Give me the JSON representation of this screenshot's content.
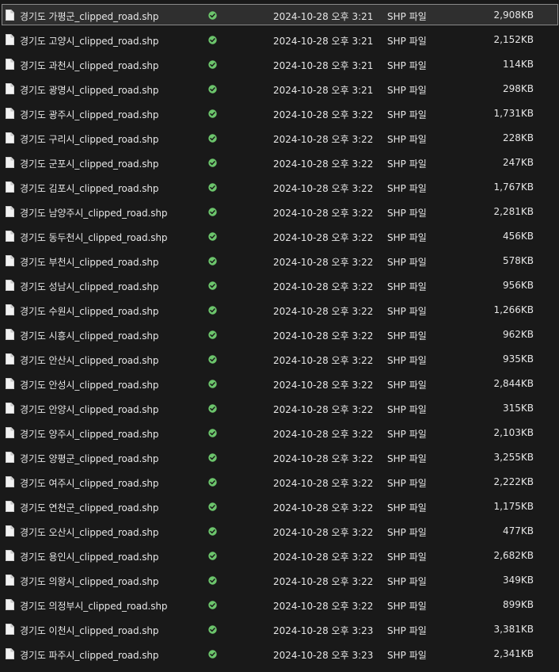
{
  "icons": {
    "file": "file-icon",
    "status": "sync-check-icon"
  },
  "colors": {
    "background": "#191919",
    "text": "#e6e6e6",
    "selection_border": "#8a8a8a",
    "status_green": "#6cc56c"
  },
  "files": [
    {
      "name": "경기도 가평군_clipped_road.shp",
      "date": "2024-10-28 오후 3:21",
      "type": "SHP 파일",
      "size": "2,908KB",
      "selected": true
    },
    {
      "name": "경기도 고양시_clipped_road.shp",
      "date": "2024-10-28 오후 3:21",
      "type": "SHP 파일",
      "size": "2,152KB"
    },
    {
      "name": "경기도 과천시_clipped_road.shp",
      "date": "2024-10-28 오후 3:21",
      "type": "SHP 파일",
      "size": "114KB"
    },
    {
      "name": "경기도 광명시_clipped_road.shp",
      "date": "2024-10-28 오후 3:21",
      "type": "SHP 파일",
      "size": "298KB"
    },
    {
      "name": "경기도 광주시_clipped_road.shp",
      "date": "2024-10-28 오후 3:22",
      "type": "SHP 파일",
      "size": "1,731KB"
    },
    {
      "name": "경기도 구리시_clipped_road.shp",
      "date": "2024-10-28 오후 3:22",
      "type": "SHP 파일",
      "size": "228KB"
    },
    {
      "name": "경기도 군포시_clipped_road.shp",
      "date": "2024-10-28 오후 3:22",
      "type": "SHP 파일",
      "size": "247KB"
    },
    {
      "name": "경기도 김포시_clipped_road.shp",
      "date": "2024-10-28 오후 3:22",
      "type": "SHP 파일",
      "size": "1,767KB"
    },
    {
      "name": "경기도 남양주시_clipped_road.shp",
      "date": "2024-10-28 오후 3:22",
      "type": "SHP 파일",
      "size": "2,281KB"
    },
    {
      "name": "경기도 동두천시_clipped_road.shp",
      "date": "2024-10-28 오후 3:22",
      "type": "SHP 파일",
      "size": "456KB"
    },
    {
      "name": "경기도 부천시_clipped_road.shp",
      "date": "2024-10-28 오후 3:22",
      "type": "SHP 파일",
      "size": "578KB"
    },
    {
      "name": "경기도 성남시_clipped_road.shp",
      "date": "2024-10-28 오후 3:22",
      "type": "SHP 파일",
      "size": "956KB"
    },
    {
      "name": "경기도 수원시_clipped_road.shp",
      "date": "2024-10-28 오후 3:22",
      "type": "SHP 파일",
      "size": "1,266KB"
    },
    {
      "name": "경기도 시흥시_clipped_road.shp",
      "date": "2024-10-28 오후 3:22",
      "type": "SHP 파일",
      "size": "962KB"
    },
    {
      "name": "경기도 안산시_clipped_road.shp",
      "date": "2024-10-28 오후 3:22",
      "type": "SHP 파일",
      "size": "935KB"
    },
    {
      "name": "경기도 안성시_clipped_road.shp",
      "date": "2024-10-28 오후 3:22",
      "type": "SHP 파일",
      "size": "2,844KB"
    },
    {
      "name": "경기도 안양시_clipped_road.shp",
      "date": "2024-10-28 오후 3:22",
      "type": "SHP 파일",
      "size": "315KB"
    },
    {
      "name": "경기도 양주시_clipped_road.shp",
      "date": "2024-10-28 오후 3:22",
      "type": "SHP 파일",
      "size": "2,103KB"
    },
    {
      "name": "경기도 양평군_clipped_road.shp",
      "date": "2024-10-28 오후 3:22",
      "type": "SHP 파일",
      "size": "3,255KB"
    },
    {
      "name": "경기도 여주시_clipped_road.shp",
      "date": "2024-10-28 오후 3:22",
      "type": "SHP 파일",
      "size": "2,222KB"
    },
    {
      "name": "경기도 연천군_clipped_road.shp",
      "date": "2024-10-28 오후 3:22",
      "type": "SHP 파일",
      "size": "1,175KB"
    },
    {
      "name": "경기도 오산시_clipped_road.shp",
      "date": "2024-10-28 오후 3:22",
      "type": "SHP 파일",
      "size": "477KB"
    },
    {
      "name": "경기도 용인시_clipped_road.shp",
      "date": "2024-10-28 오후 3:22",
      "type": "SHP 파일",
      "size": "2,682KB"
    },
    {
      "name": "경기도 의왕시_clipped_road.shp",
      "date": "2024-10-28 오후 3:22",
      "type": "SHP 파일",
      "size": "349KB"
    },
    {
      "name": "경기도 의정부시_clipped_road.shp",
      "date": "2024-10-28 오후 3:22",
      "type": "SHP 파일",
      "size": "899KB"
    },
    {
      "name": "경기도 이천시_clipped_road.shp",
      "date": "2024-10-28 오후 3:23",
      "type": "SHP 파일",
      "size": "3,381KB"
    },
    {
      "name": "경기도 파주시_clipped_road.shp",
      "date": "2024-10-28 오후 3:23",
      "type": "SHP 파일",
      "size": "2,341KB"
    }
  ]
}
